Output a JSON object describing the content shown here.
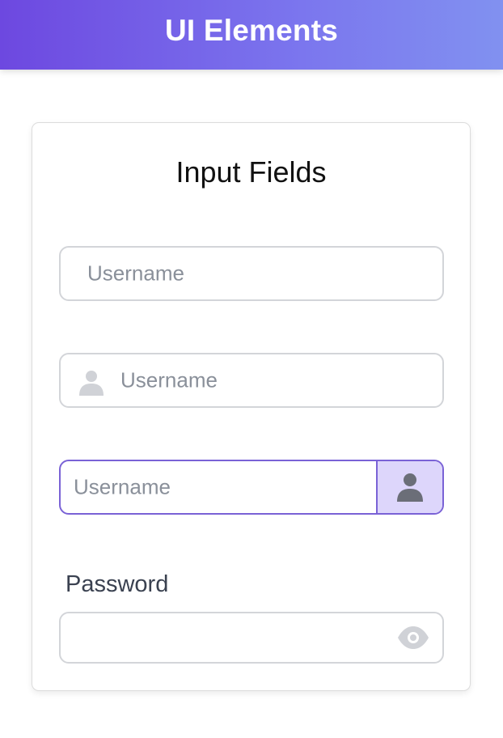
{
  "header": {
    "title": "UI Elements"
  },
  "card": {
    "title": "Input Fields",
    "fields": [
      {
        "placeholder": "Username"
      },
      {
        "placeholder": "Username",
        "icon": "user-icon"
      },
      {
        "placeholder": "Username",
        "addon_icon": "user-icon"
      },
      {
        "label": "Password",
        "value": "",
        "icon": "eye-icon"
      }
    ]
  },
  "colors": {
    "header_gradient_start": "#6d48e0",
    "header_gradient_end": "#8191f0",
    "focus_border": "#7a62d6",
    "addon_bg": "#ddd6fb"
  }
}
